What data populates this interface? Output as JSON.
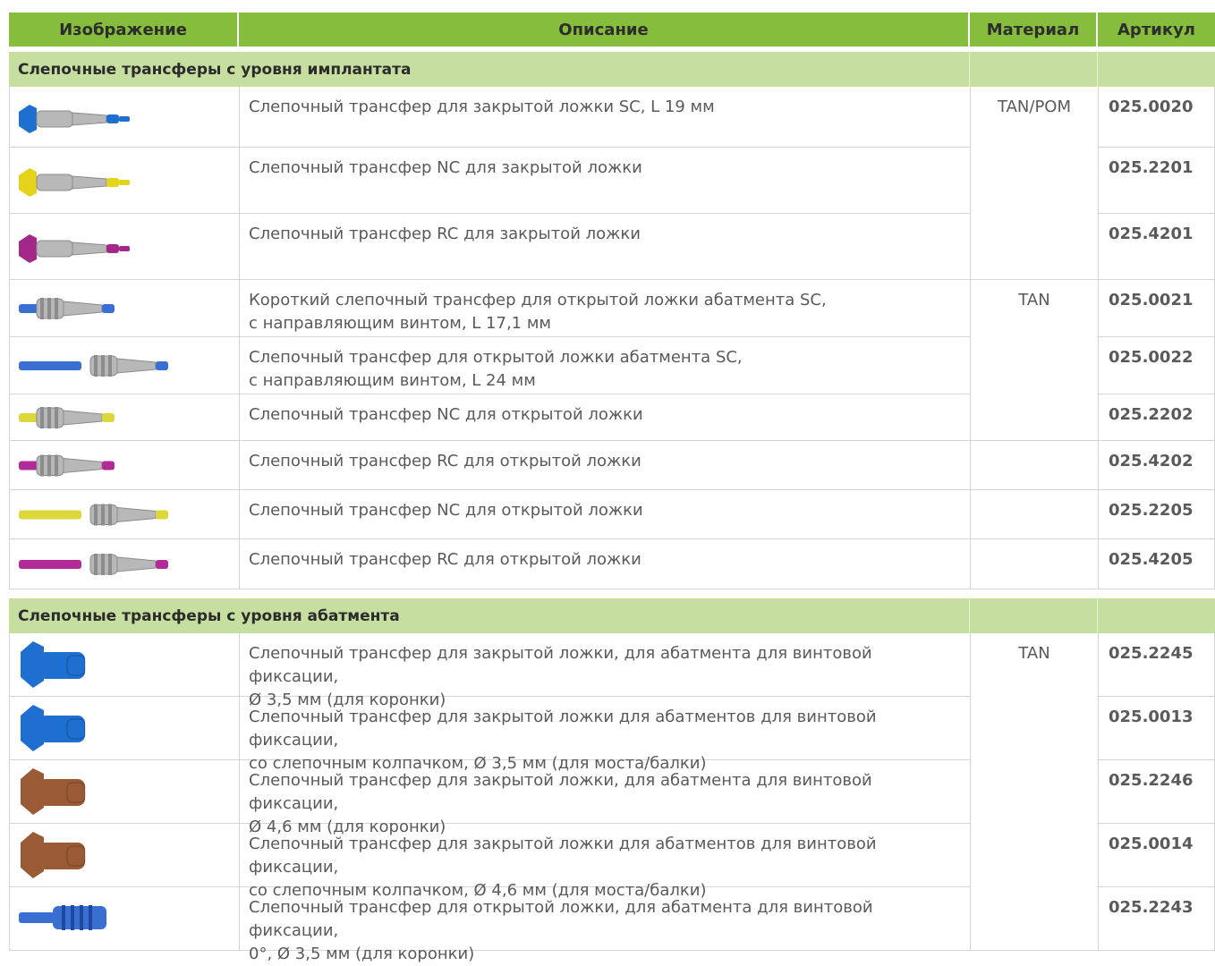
{
  "header": {
    "image": "Изображение",
    "description": "Описание",
    "material": "Материал",
    "article": "Артикул"
  },
  "sections": [
    {
      "title": "Слепочные трансферы с уровня имплантата",
      "rows": [
        {
          "desc": [
            "Слепочный трансфер для закрытой ложки SC, L 19 мм"
          ],
          "material": "TAN/POM",
          "article": "025.0020",
          "icon": "closed-tray-transfer-blue-icon",
          "color": "#1e6fd0"
        },
        {
          "desc": [
            "Слепочный трансфер NC для закрытой ложки"
          ],
          "material": "",
          "article": "025.2201",
          "icon": "closed-tray-transfer-yellow-icon",
          "color": "#e3d31a"
        },
        {
          "desc": [
            "Слепочный трансфер RC для закрытой ложки"
          ],
          "material": "",
          "article": "025.4201",
          "icon": "closed-tray-transfer-magenta-icon",
          "color": "#a4288a"
        },
        {
          "desc": [
            "Короткий слепочный трансфер для открытой ложки абатмента SC,",
            "с направляющим винтом, L 17,1 мм"
          ],
          "material": "TAN",
          "article": "025.0021",
          "icon": "open-tray-transfer-short-blue-icon",
          "color": "#3a6fd2"
        },
        {
          "desc": [
            "Слепочный трансфер для открытой ложки абатмента SC,",
            "с направляющим винтом, L 24 мм"
          ],
          "material": "",
          "article": "025.0022",
          "icon": "open-tray-transfer-long-blue-icon",
          "color": "#3a6fd2"
        },
        {
          "desc": [
            "Слепочный трансфер NC для открытой ложки"
          ],
          "material": "",
          "article": "025.2202",
          "icon": "open-tray-transfer-yellow-icon",
          "color": "#dcd83a"
        },
        {
          "desc": [
            "Слепочный трансфер RC для открытой ложки"
          ],
          "material": "",
          "article": "025.4202",
          "icon": "open-tray-transfer-magenta-icon",
          "color": "#b02a98"
        },
        {
          "desc": [
            "Слепочный трансфер NC для открытой ложки"
          ],
          "material": "",
          "article": "025.2205",
          "icon": "open-tray-transfer-long-yellow-icon",
          "color": "#dcd83a"
        },
        {
          "desc": [
            "Слепочный трансфер RC для открытой ложки"
          ],
          "material": "",
          "article": "025.4205",
          "icon": "open-tray-transfer-long-magenta-icon",
          "color": "#b02a98"
        }
      ]
    },
    {
      "title": "Слепочные трансферы с уровня абатмента",
      "rows": [
        {
          "desc": [
            "Слепочный трансфер для закрытой ложки, для абатмента для винтовой фиксации,",
            "Ø 3,5 мм (для коронки)"
          ],
          "material": "TAN",
          "article": "025.2245",
          "icon": "abutment-transfer-blue-icon",
          "color": "#1e6fd0"
        },
        {
          "desc": [
            "Слепочный трансфер для закрытой ложки для абатментов для винтовой фиксации,",
            "со слепочным колпачком, Ø 3,5 мм (для моста/балки)"
          ],
          "material": "",
          "article": "025.0013",
          "icon": "abutment-transfer-cap-blue-icon",
          "color": "#1e6fd0"
        },
        {
          "desc": [
            "Слепочный трансфер для закрытой ложки, для абатмента для винтовой фиксации,",
            "Ø 4,6 мм (для коронки)"
          ],
          "material": "",
          "article": "025.2246",
          "icon": "abutment-transfer-brown-icon",
          "color": "#9a5a35"
        },
        {
          "desc": [
            "Слепочный трансфер для закрытой ложки для абатментов для винтовой фиксации,",
            "со слепочным колпачком, Ø 4,6 мм (для моста/балки)"
          ],
          "material": "",
          "article": "025.0014",
          "icon": "abutment-transfer-cap-brown-icon",
          "color": "#9a5a35"
        },
        {
          "desc": [
            "Слепочный трансфер для открытой ложки, для абатмента для винтовой фиксации,",
            "0°, Ø 3,5 мм (для коронки)"
          ],
          "material": "",
          "article": "025.2243",
          "icon": "abutment-open-transfer-blue-icon",
          "color": "#3a6fd2"
        }
      ]
    }
  ],
  "colors": {
    "header_bg": "#86bd3c",
    "section_bg": "#c6dfa0",
    "grid": "#d5d5d5"
  }
}
